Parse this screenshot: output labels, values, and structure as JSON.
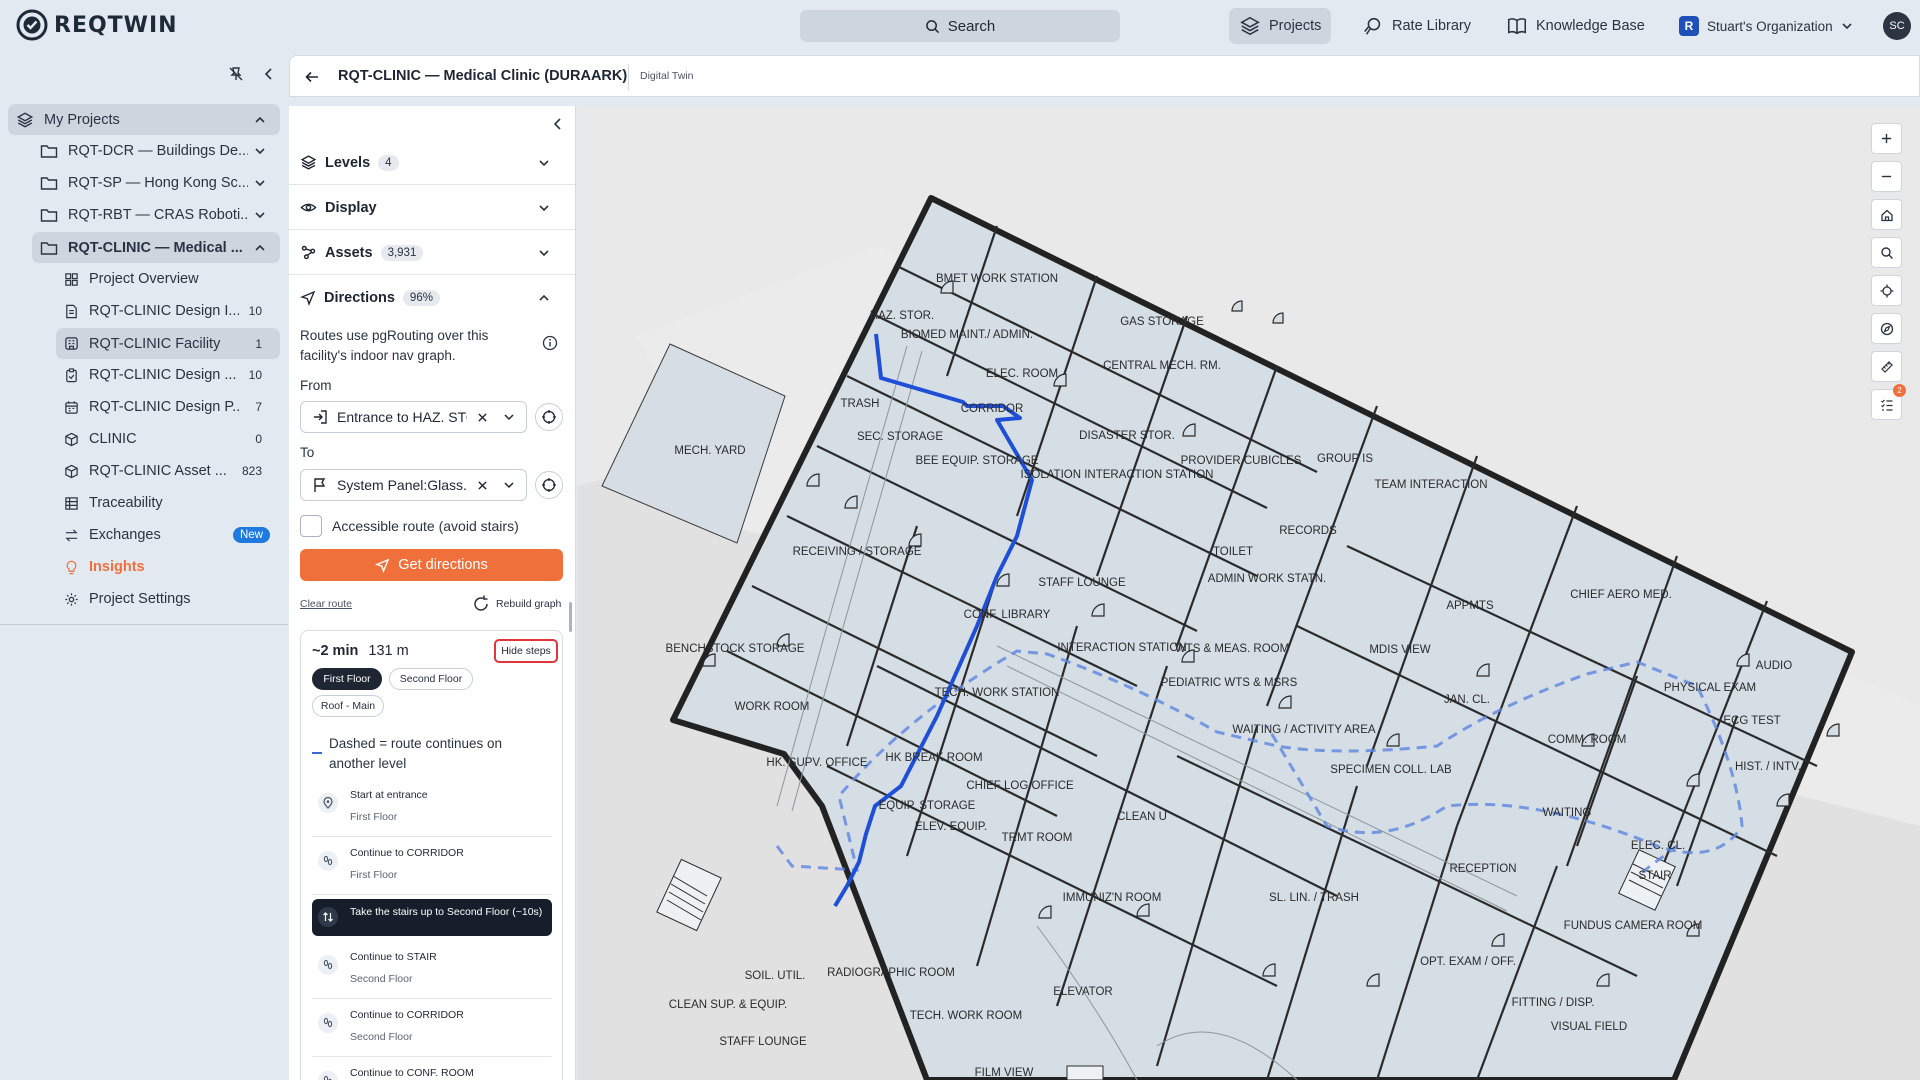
{
  "app": {
    "logo_text": "REQTWIN",
    "search_label": "Search",
    "nav": [
      {
        "label": "Projects",
        "active": true,
        "icon": "layers-icon"
      },
      {
        "label": "Rate Library",
        "active": false,
        "icon": "badge-icon"
      },
      {
        "label": "Knowledge Base",
        "active": false,
        "icon": "book-icon"
      }
    ],
    "org_name": "Stuart's Organization",
    "avatar_initials": "SC",
    "colors": {
      "accent": "#f0703c",
      "route": "#1f4fd6",
      "new_badge": "#1f7ae0"
    }
  },
  "sidebar": {
    "root_label": "My Projects",
    "projects": [
      {
        "label": "RQT-DCR — Buildings De..."
      },
      {
        "label": "RQT-SP — Hong Kong Sc..."
      },
      {
        "label": "RQT-RBT — CRAS Roboti..."
      },
      {
        "label": "RQT-CLINIC — Medical ..."
      }
    ],
    "children": [
      {
        "label": "Project Overview",
        "count": "",
        "icon": "dashboard-icon"
      },
      {
        "label": "RQT-CLINIC Design I...",
        "count": "10",
        "icon": "document-icon"
      },
      {
        "label": "RQT-CLINIC Facility",
        "count": "1",
        "icon": "building-icon"
      },
      {
        "label": "RQT-CLINIC Design ...",
        "count": "10",
        "icon": "clipboard-icon"
      },
      {
        "label": "RQT-CLINIC Design P...",
        "count": "7",
        "icon": "calendar-icon"
      },
      {
        "label": "CLINIC",
        "count": "0",
        "icon": "cube-icon"
      },
      {
        "label": "RQT-CLINIC Asset ...",
        "count": "823",
        "icon": "cube-icon"
      },
      {
        "label": "Traceability",
        "count": "",
        "icon": "table-icon"
      },
      {
        "label": "Exchanges",
        "count": "",
        "icon": "exchange-icon"
      },
      {
        "label": "Insights",
        "count": "",
        "icon": "lightbulb-icon"
      },
      {
        "label": "Project Settings",
        "count": "",
        "icon": "gear-icon"
      }
    ],
    "new_badge": "New"
  },
  "header": {
    "title": "RQT-CLINIC — Medical Clinic (DURAARK)",
    "subtitle": "Digital Twin"
  },
  "panel": {
    "levels": {
      "label": "Levels",
      "count": "4"
    },
    "display": {
      "label": "Display"
    },
    "assets": {
      "label": "Assets",
      "count": "3,931"
    },
    "directions": {
      "label": "Directions",
      "count": "96%"
    },
    "description": "Routes use pgRouting over this facility's indoor nav graph.",
    "from_label": "From",
    "from_value": "Entrance to HAZ. STOR.",
    "to_label": "To",
    "to_value": "System Panel:Glass...",
    "accessible_label": "Accessible route (avoid stairs)",
    "get_directions": "Get directions",
    "clear_route": "Clear route",
    "rebuild_graph": "Rebuild graph",
    "result": {
      "time": "~2 min",
      "distance": "131 m",
      "hide_steps": "Hide steps",
      "floors": [
        "First Floor",
        "Second Floor",
        "Roof - Main"
      ],
      "active_floor": "First Floor",
      "note": "Dashed = route continues on another level",
      "steps": [
        {
          "text": "Start at entrance",
          "floor": "First Floor",
          "icon": "pin-icon"
        },
        {
          "text": "Continue to CORRIDOR",
          "floor": "First Floor",
          "icon": "footsteps-icon"
        },
        {
          "text": "Take the stairs up to Second Floor (~10s)",
          "floor": "",
          "icon": "stairs-icon",
          "active": true
        },
        {
          "text": "Continue to STAIR",
          "floor": "Second Floor",
          "icon": "footsteps-icon"
        },
        {
          "text": "Continue to CORRIDOR",
          "floor": "Second Floor",
          "icon": "footsteps-icon"
        },
        {
          "text": "Continue to CONF. ROOM",
          "floor": "",
          "icon": "footsteps-icon"
        }
      ]
    }
  },
  "map": {
    "room_labels": [
      "BMET WORK STATION",
      "HAZ. STOR.",
      "BIOMED MAINT./ ADMIN.",
      "ELEC. ROOM",
      "GAS STORAGE",
      "CENTRAL MECH. RM.",
      "TRASH",
      "CORRIDOR",
      "SEC. STORAGE",
      "BEE EQUIP. STORAGE",
      "DISASTER STOR.",
      "MECH. YARD",
      "PROVIDER CUBICLES",
      "GROUP IS",
      "TEAM INTERACTION",
      "ISOLATION INTERACTION STATION",
      "RECORDS",
      "RECEIVING / STORAGE",
      "STAFF LOUNGE",
      "TOILET",
      "ADMIN WORK STATN.",
      "APPMTS",
      "CHIEF AERO MED.",
      "CONF. LIBRARY",
      "INTERACTION STATION",
      "WTS & MEAS. ROOM",
      "MDIS VIEW",
      "AUDIO",
      "BENCHSTOCK STORAGE",
      "TECH. WORK STATION",
      "PEDIATRIC WTS & MSRS",
      "JAN. CL.",
      "PHYSICAL EXAM",
      "WORK ROOM",
      "WAITING / ACTIVITY AREA",
      "COMM. ROOM",
      "ECG TEST",
      "HK. SUPV. OFFICE",
      "HK BREAK ROOM",
      "SPECIMEN COLL. LAB",
      "HIST. / INTV.",
      "CHIEF LOG OFFICE",
      "CLEAN U",
      "EQUIP. STORAGE",
      "ELEV. EQUIP.",
      "TRMT ROOM",
      "WAITING",
      "ELEC. CL.",
      "STAIR",
      "RECEPTION",
      "IMMUNIZ'N ROOM",
      "SL. LIN. / TRASH",
      "FUNDUS CAMERA ROOM",
      "RADIOGRAPHIC ROOM",
      "OPT. EXAM / OFF.",
      "SOIL. UTIL.",
      "ELEVATOR",
      "CLEAN SUP. & EQUIP.",
      "TECH. WORK ROOM",
      "FITTING / DISP.",
      "VISUAL FIELD",
      "STAFF LOUNGE",
      "FILM VIEW"
    ]
  }
}
